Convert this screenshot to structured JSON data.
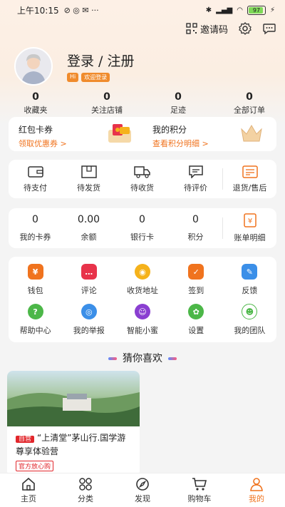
{
  "status_bar": {
    "time": "上午10:15",
    "battery": "97"
  },
  "header": {
    "invite_label": "邀请码"
  },
  "profile": {
    "login_label": "登录 / 注册",
    "tag_hi": "Hi",
    "tag_welcome": "欢迎登录"
  },
  "stats": [
    {
      "value": "0",
      "label": "收藏夹"
    },
    {
      "value": "0",
      "label": "关注店铺"
    },
    {
      "value": "0",
      "label": "足迹"
    },
    {
      "value": "0",
      "label": "全部订单"
    }
  ],
  "promo": {
    "wallet_title": "红包卡券",
    "wallet_link": "领取优惠券 >",
    "points_title": "我的积分",
    "points_link": "查看积分明细 >"
  },
  "orders": [
    {
      "label": "待支付",
      "icon": "wallet-icon"
    },
    {
      "label": "待发货",
      "icon": "package-icon"
    },
    {
      "label": "待收货",
      "icon": "truck-icon"
    },
    {
      "label": "待评价",
      "icon": "comment-icon"
    },
    {
      "label": "退货/售后",
      "icon": "refund-icon"
    }
  ],
  "money": [
    {
      "value": "0",
      "label": "我的卡券"
    },
    {
      "value": "0.00",
      "label": "余额"
    },
    {
      "value": "0",
      "label": "银行卡"
    },
    {
      "value": "0",
      "label": "积分"
    },
    {
      "value": "",
      "label": "账单明细"
    }
  ],
  "services_row1": [
    {
      "label": "钱包",
      "color": "#f0731e"
    },
    {
      "label": "评论",
      "color": "#e8334a"
    },
    {
      "label": "收货地址",
      "color": "#f5b21b"
    },
    {
      "label": "签到",
      "color": "#f0731e"
    },
    {
      "label": "反馈",
      "color": "#3b8fe8"
    }
  ],
  "services_row2": [
    {
      "label": "帮助中心",
      "color": "#4cb748"
    },
    {
      "label": "我的举报",
      "color": "#3b8fe8"
    },
    {
      "label": "智能小蜜",
      "color": "#8a3fd1"
    },
    {
      "label": "设置",
      "color": "#4cb748"
    },
    {
      "label": "我的团队",
      "color": "#4cb748"
    }
  ],
  "guess_title": "猜你喜欢",
  "product": {
    "self_tag": "自营",
    "title": "“上清堂”茅山行.国学游 尊享体验营",
    "official_tag": "官方放心购"
  },
  "tabbar": [
    {
      "label": "主页",
      "icon": "home-icon"
    },
    {
      "label": "分类",
      "icon": "category-icon"
    },
    {
      "label": "发现",
      "icon": "compass-icon"
    },
    {
      "label": "购物车",
      "icon": "cart-icon"
    },
    {
      "label": "我的",
      "icon": "user-icon"
    }
  ],
  "colors": {
    "accent": "#f0731e",
    "red": "#e2262b"
  }
}
